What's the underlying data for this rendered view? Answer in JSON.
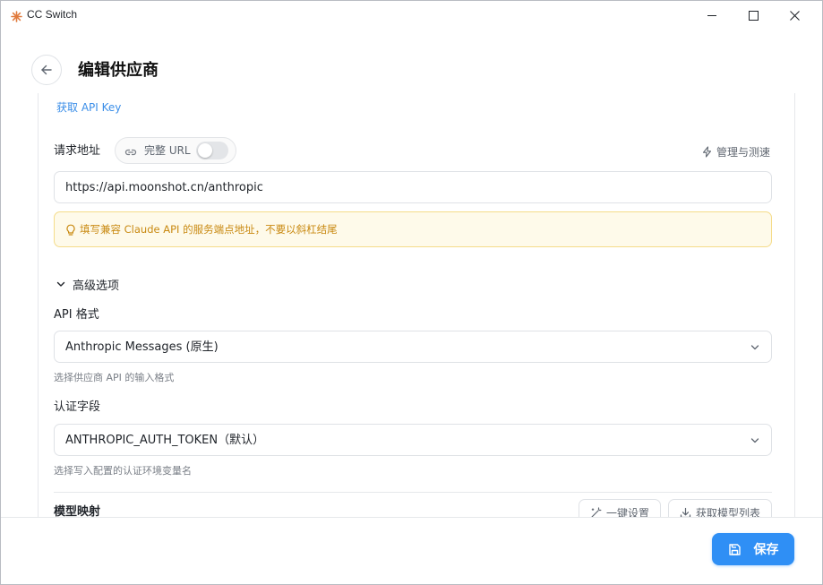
{
  "window": {
    "title": "CC Switch",
    "icon": "app-logo-icon",
    "controls": [
      "minimize-icon",
      "maximize-icon",
      "close-icon"
    ]
  },
  "header": {
    "title": "编辑供应商",
    "back_icon": "arrow-left-icon"
  },
  "api_key": {
    "get_link": "获取 API Key"
  },
  "request_url": {
    "label": "请求地址",
    "full_url_toggle_label": "完整 URL",
    "full_url_enabled": false,
    "manage_label": "管理与测速",
    "value": "https://api.moonshot.cn/anthropic",
    "hint": "填写兼容 Claude API 的服务端点地址，不要以斜杠结尾"
  },
  "advanced": {
    "toggle_label": "高级选项",
    "expanded": true,
    "api_format": {
      "label": "API 格式",
      "value": "Anthropic Messages (原生)",
      "hint": "选择供应商 API 的输入格式"
    },
    "auth_field": {
      "label": "认证字段",
      "value": "ANTHROPIC_AUTH_TOKEN（默认）",
      "hint": "选择写入配置的认证环境变量名"
    }
  },
  "model_mapping": {
    "label": "模型映射",
    "one_click_label": "一键设置",
    "fetch_models_label": "获取模型列表"
  },
  "footer": {
    "save_label": "保存"
  },
  "colors": {
    "accent": "#2f8ff5",
    "link": "#3b8ee8",
    "warning_text": "#c98a12",
    "warning_bg": "#fefaea"
  }
}
